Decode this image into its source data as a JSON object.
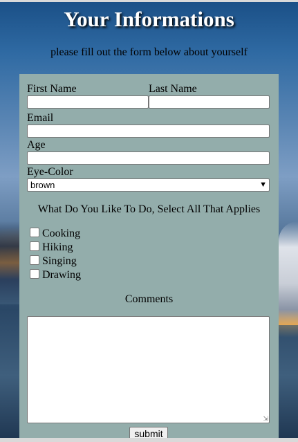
{
  "header": {
    "title": "Your Informations",
    "subtitle": "please fill out the form below about yourself"
  },
  "form": {
    "first_name_label": "First Name",
    "first_name_value": "",
    "last_name_label": "Last Name",
    "last_name_value": "",
    "email_label": "Email",
    "email_value": "",
    "age_label": "Age",
    "age_value": "",
    "eye_color_label": "Eye-Color",
    "eye_color_selected": "brown",
    "activities_question": "What Do You Like To Do, Select All That Applies",
    "activities": [
      {
        "label": "Cooking",
        "checked": false
      },
      {
        "label": "Hiking",
        "checked": false
      },
      {
        "label": "Singing",
        "checked": false
      },
      {
        "label": "Drawing",
        "checked": false
      }
    ],
    "comments_label": "Comments",
    "comments_value": "",
    "submit_label": "submit"
  },
  "icons": {
    "select_arrow": "chevron-down-icon",
    "textarea_grip": "resize-grip-icon"
  },
  "colors": {
    "form_background": "#93adab",
    "title_color": "#ffffff"
  }
}
